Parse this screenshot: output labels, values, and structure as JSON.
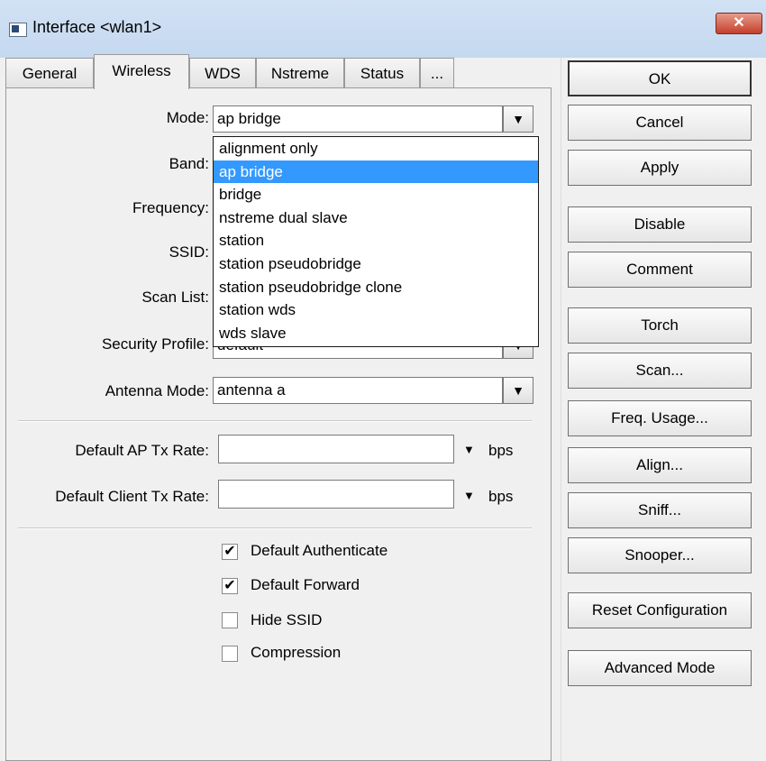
{
  "window": {
    "title": "Interface <wlan1>",
    "close_label": "✕"
  },
  "tabs": [
    {
      "label": "General"
    },
    {
      "label": "Wireless"
    },
    {
      "label": "WDS"
    },
    {
      "label": "Nstreme"
    },
    {
      "label": "Status"
    },
    {
      "label": "..."
    }
  ],
  "fields": {
    "mode": {
      "label": "Mode:",
      "value": "ap bridge"
    },
    "band": {
      "label": "Band:"
    },
    "frequency": {
      "label": "Frequency:"
    },
    "ssid": {
      "label": "SSID:"
    },
    "scan_list": {
      "label": "Scan List:"
    },
    "security_profile": {
      "label": "Security Profile:",
      "value": "default"
    },
    "antenna_mode": {
      "label": "Antenna Mode:",
      "value": "antenna a"
    },
    "default_ap_tx_rate": {
      "label": "Default AP Tx Rate:",
      "value": "",
      "unit": "bps"
    },
    "default_client_tx_rate": {
      "label": "Default Client Tx Rate:",
      "value": "",
      "unit": "bps"
    }
  },
  "mode_options": [
    "alignment only",
    "ap bridge",
    "bridge",
    "nstreme dual slave",
    "station",
    "station pseudobridge",
    "station pseudobridge clone",
    "station wds",
    "wds slave"
  ],
  "mode_selected": "ap bridge",
  "checkboxes": [
    {
      "label": "Default Authenticate",
      "checked": true
    },
    {
      "label": "Default Forward",
      "checked": true
    },
    {
      "label": "Hide SSID",
      "checked": false
    },
    {
      "label": "Compression",
      "checked": false
    }
  ],
  "buttons": {
    "ok": "OK",
    "cancel": "Cancel",
    "apply": "Apply",
    "disable": "Disable",
    "comment": "Comment",
    "torch": "Torch",
    "scan": "Scan...",
    "freq_usage": "Freq. Usage...",
    "align": "Align...",
    "sniff": "Sniff...",
    "snooper": "Snooper...",
    "reset_configuration": "Reset Configuration",
    "advanced_mode": "Advanced Mode"
  },
  "colors": {
    "selection": "#3399ff",
    "titlebar": "#c4d8f0",
    "close": "#c4402c"
  }
}
